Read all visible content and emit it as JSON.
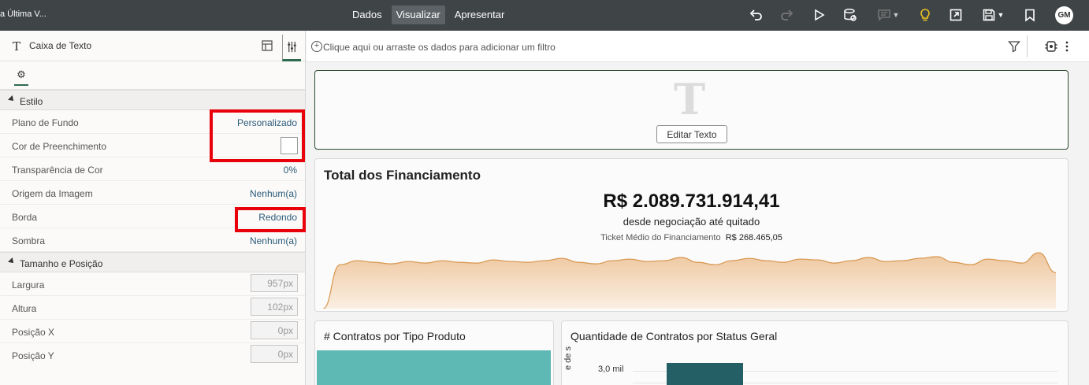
{
  "topbar": {
    "title": "a Última V...",
    "tabs": [
      {
        "label": "Dados"
      },
      {
        "label": "Visualizar"
      },
      {
        "label": "Apresentar"
      }
    ],
    "avatar": "GM"
  },
  "panel": {
    "header_title": "Caixa de Texto",
    "sections": {
      "style": {
        "title": "Estilo",
        "background_label": "Plano de Fundo",
        "background_value": "Personalizado",
        "fill_color_label": "Cor de Preenchimento",
        "fill_color_value": "#ffffff",
        "transparency_label": "Transparência de Cor",
        "transparency_value": "0%",
        "image_source_label": "Origem da Imagem",
        "image_source_value": "Nenhum(a)",
        "border_label": "Borda",
        "border_value": "Redondo",
        "shadow_label": "Sombra",
        "shadow_value": "Nenhum(a)"
      },
      "size": {
        "title": "Tamanho e Posição",
        "width_label": "Largura",
        "width_value": "957px",
        "height_label": "Altura",
        "height_value": "102px",
        "posx_label": "Posição X",
        "posx_value": "0px",
        "posy_label": "Posição Y",
        "posy_value": "0px"
      }
    }
  },
  "filterbar": {
    "placeholder": "Clique aqui ou arraste os dados para adicionar um filtro"
  },
  "canvas": {
    "text_card": {
      "edit_button": "Editar Texto"
    },
    "kpi": {
      "title": "Total dos Financiamento",
      "value": "R$ 2.089.731.914,41",
      "subtitle": "desde negociação até quitado",
      "metric_label": "Ticket Médio do Financiamento",
      "metric_value": "R$ 268.465,05"
    },
    "chart1": {
      "title": "# Contratos por Tipo Produto"
    },
    "chart2": {
      "title": "Quantidade de Contratos por Status Geral",
      "ytick": "3,0 mil",
      "ylabel_fragment": "e de s"
    }
  },
  "colors": {
    "topbar": "#3f4447",
    "accent": "#2d6a4f",
    "highlight": "#e8000b",
    "sparkline_fill": "#eec79f",
    "sparkline_line": "#d99a55",
    "bar_teal": "#5eb8b4",
    "bar_dark": "#245f65"
  },
  "chart_data": {
    "type": "area",
    "title": "",
    "values": [
      0,
      55,
      60,
      58,
      56,
      59,
      57,
      60,
      58,
      57,
      61,
      59,
      58,
      60,
      63,
      58,
      56,
      60,
      62,
      59,
      60,
      64,
      58,
      55,
      60,
      63,
      60,
      58,
      62,
      61,
      57,
      60,
      64,
      59,
      60,
      63,
      65,
      58,
      55,
      62,
      60,
      57,
      70,
      45
    ]
  }
}
